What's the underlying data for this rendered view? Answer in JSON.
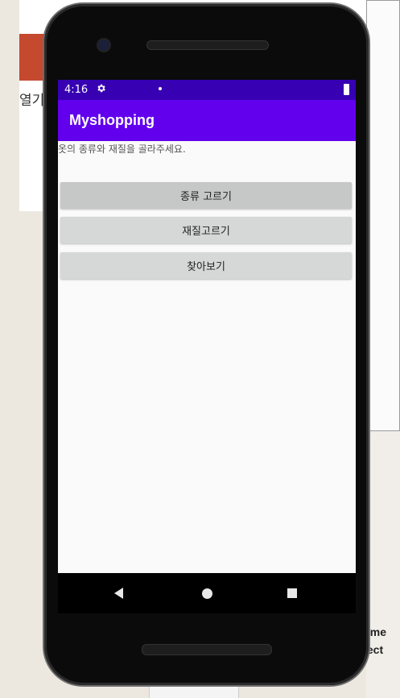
{
  "background": {
    "left_partial_text": "열기",
    "right_bold_line1": "eme",
    "right_bold_line2": "lect"
  },
  "status_bar": {
    "time": "4:16",
    "settings_icon": "gear-icon",
    "battery_icon": "battery-icon",
    "color": "#3700b3"
  },
  "app_bar": {
    "title": "Myshopping",
    "color": "#6200ee"
  },
  "main": {
    "hint_text": "옷의 종류와 재질을 골라주세요.",
    "buttons": [
      {
        "label": "종류 고르기"
      },
      {
        "label": "재질고르기"
      },
      {
        "label": "찾아보기"
      }
    ]
  },
  "nav_bar": {
    "back_icon": "back-icon",
    "home_icon": "home-icon",
    "recents_icon": "recents-icon"
  }
}
